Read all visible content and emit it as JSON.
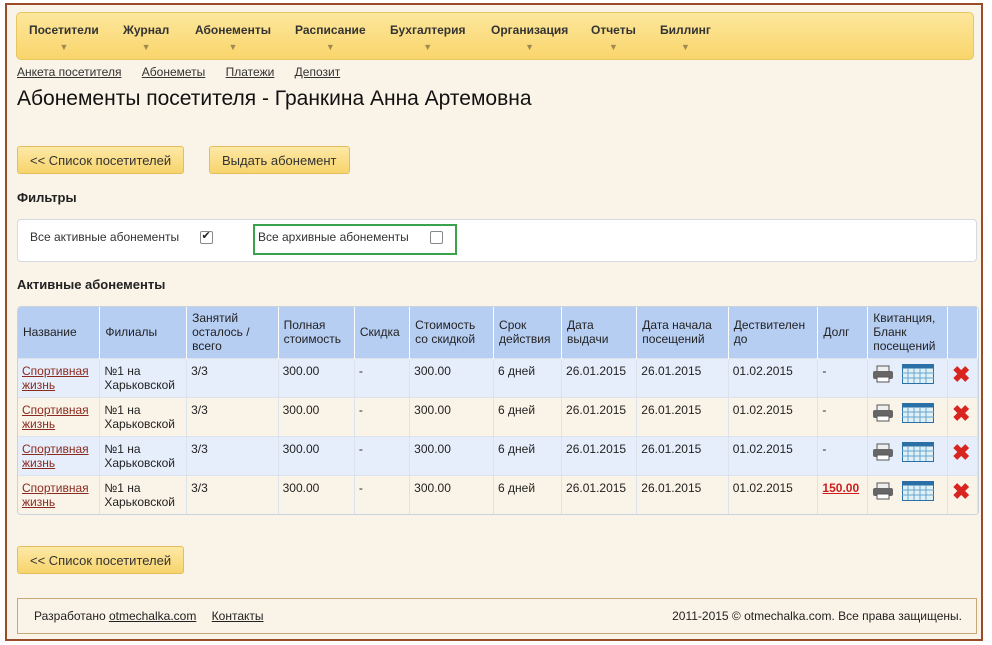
{
  "menu": [
    {
      "label": "Посетители"
    },
    {
      "label": "Журнал"
    },
    {
      "label": "Абонементы"
    },
    {
      "label": "Расписание"
    },
    {
      "label": "Бухгалтерия"
    },
    {
      "label": "Организация"
    },
    {
      "label": "Отчеты"
    },
    {
      "label": "Биллинг"
    }
  ],
  "sublinks": [
    "Анкета посетителя",
    "Абонеметы",
    "Платежи",
    "Депозит"
  ],
  "page_title": "Абонементы посетителя - Гранкина Анна Артемовна",
  "buttons": {
    "back": "<< Список посетителей",
    "issue": "Выдать абонемент"
  },
  "filters": {
    "title": "Фильтры",
    "active_label": "Все активные абонементы",
    "active_checked": true,
    "archive_label": "Все архивные абонементы",
    "archive_checked": false
  },
  "active_title": "Активные абонементы",
  "table": {
    "headers": [
      "Название",
      "Филиалы",
      "Занятий осталось / всего",
      "Полная стоимость",
      "Скидка",
      "Стоимость со скидкой",
      "Срок действия",
      "Дата выдачи",
      "Дата начала посещений",
      "Дествителен до",
      "Долг",
      "Квитанция, Бланк посещений"
    ],
    "rows": [
      {
        "name": "Спортивная жизнь",
        "branch": "№1 на Харьковской",
        "left": "3/3",
        "price": "300.00",
        "discount": "-",
        "discounted": "300.00",
        "term": "6 дней",
        "issued": "26.01.2015",
        "start": "26.01.2015",
        "valid": "01.02.2015",
        "debt": "-"
      },
      {
        "name": "Спортивная жизнь",
        "branch": "№1 на Харьковской",
        "left": "3/3",
        "price": "300.00",
        "discount": "-",
        "discounted": "300.00",
        "term": "6 дней",
        "issued": "26.01.2015",
        "start": "26.01.2015",
        "valid": "01.02.2015",
        "debt": "-"
      },
      {
        "name": "Спортивная жизнь",
        "branch": "№1 на Харьковской",
        "left": "3/3",
        "price": "300.00",
        "discount": "-",
        "discounted": "300.00",
        "term": "6 дней",
        "issued": "26.01.2015",
        "start": "26.01.2015",
        "valid": "01.02.2015",
        "debt": "-"
      },
      {
        "name": "Спортивная жизнь",
        "branch": "№1 на Харьковской",
        "left": "3/3",
        "price": "300.00",
        "discount": "-",
        "discounted": "300.00",
        "term": "6 дней",
        "issued": "26.01.2015",
        "start": "26.01.2015",
        "valid": "01.02.2015",
        "debt": "150.00"
      }
    ]
  },
  "footer": {
    "dev_prefix": "Разработано ",
    "dev_link": "otmechalka.com",
    "contacts": "Контакты",
    "copyright": "2011-2015 © otmechalka.com. Все права защищены."
  },
  "icons": {
    "printer": "printer-icon",
    "sheet": "attendance-sheet-icon",
    "delete": "delete-icon",
    "menu_arrow": "chevron-down-icon"
  },
  "colors": {
    "menu_bg": "#f9d56b",
    "header_bg": "#b7cef3",
    "debt": "#cc1e1e",
    "delete": "#d9251f",
    "archive_border": "#3aa24a"
  }
}
